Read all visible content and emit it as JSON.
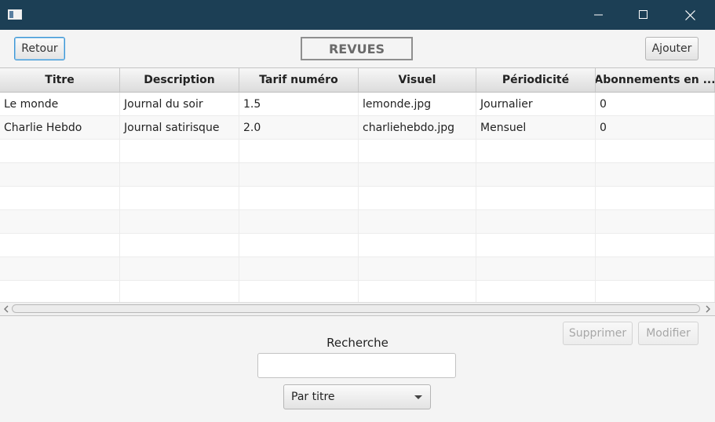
{
  "window": {
    "title": ""
  },
  "toolbar": {
    "back_label": "Retour",
    "page_title": "REVUES",
    "add_label": "Ajouter"
  },
  "table": {
    "columns": [
      "Titre",
      "Description",
      "Tarif numéro",
      "Visuel",
      "Périodicité",
      "Abonnements en ..."
    ],
    "rows": [
      [
        "Le monde",
        "Journal du soir",
        "1.5",
        "lemonde.jpg",
        "Journalier",
        "0"
      ],
      [
        "Charlie Hebdo",
        "Journal satirisque",
        "2.0",
        "charliehebdo.jpg",
        "Mensuel",
        "0"
      ]
    ]
  },
  "actions": {
    "delete_label": "Supprimer",
    "edit_label": "Modifier"
  },
  "search": {
    "label": "Recherche",
    "value": "",
    "mode_selected": "Par titre"
  },
  "colors": {
    "titlebar": "#1c3f55",
    "focus_border": "#3b96d6"
  }
}
